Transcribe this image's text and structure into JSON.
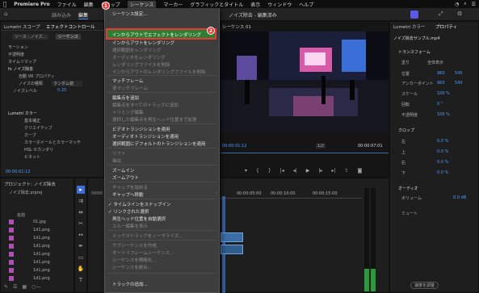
{
  "menubar": {
    "app_name": "Premiere Pro",
    "items": [
      "ファイル",
      "編集",
      "クリップ",
      "シーケンス",
      "マーカー",
      "グラフィックとタイトル",
      "表示",
      "ウィンドウ",
      "ヘルプ"
    ],
    "active": "シーケンス"
  },
  "workspace": {
    "tabs": [
      "読み込み",
      "編集"
    ],
    "doc_title": "ノイズ除去 - 編集済み"
  },
  "effect_controls": {
    "tabs": [
      "Lumetri スコープ",
      "エフェクトコントロール"
    ],
    "source_label": "ソース : ノイズ…",
    "seq_label": "シーケンス",
    "items": [
      {
        "label": "モーション"
      },
      {
        "label": "不透明度"
      },
      {
        "label": "タイムリマップ"
      },
      {
        "label": "fx ノイズ除去"
      },
      {
        "label": "自動 VR プロパティ"
      },
      {
        "label": "ノイズの種類",
        "value": "ランダム値"
      },
      {
        "label": "ノイズレベル",
        "value": "0.20"
      },
      {
        "label": "Lumetri カラー"
      },
      {
        "label": "基本補正"
      },
      {
        "label": "クリエイティブ"
      },
      {
        "label": "カーブ"
      },
      {
        "label": "カラーホイールとカラーマッチ"
      },
      {
        "label": "HSL セカンダリ"
      },
      {
        "label": "ビネット"
      }
    ],
    "timecode": "00:00:01:12"
  },
  "sequence_menu": {
    "items": [
      {
        "label": "シーケンス設定...",
        "enabled": true
      },
      {
        "label": "インからアウトでエフェクトをレンダリング",
        "enabled": true,
        "shortcut": "↵",
        "highlighted": true
      },
      {
        "label": "インからアウトをレンダリング",
        "enabled": true
      },
      {
        "label": "選択範囲をレンダリング",
        "enabled": false
      },
      {
        "label": "オーディオをレンダリング",
        "enabled": false
      },
      {
        "label": "レンダリングファイルを削除",
        "enabled": false
      },
      {
        "label": "インからアウトのレンダリングファイルを削除",
        "enabled": false
      },
      {
        "label": "マッチフレーム",
        "enabled": true
      },
      {
        "label": "逆マッチフレーム",
        "enabled": false
      },
      {
        "label": "編集点を追加",
        "enabled": true
      },
      {
        "label": "編集点をすべてのトラックに追加",
        "enabled": false
      },
      {
        "label": "トリミング編集",
        "enabled": false
      },
      {
        "label": "選択した編集点を再生ヘッド位置まで拡張",
        "enabled": false
      },
      {
        "label": "ビデオトランジションを適用",
        "enabled": true
      },
      {
        "label": "オーディオトランジションを適用",
        "enabled": true
      },
      {
        "label": "選択範囲にデフォルトのトランジションを適用",
        "enabled": true
      },
      {
        "label": "リフト",
        "enabled": false
      },
      {
        "label": "抽出",
        "enabled": false
      },
      {
        "label": "ズームイン",
        "enabled": true
      },
      {
        "label": "ズームアウト",
        "enabled": true
      },
      {
        "label": "ギャップを詰める",
        "enabled": false
      },
      {
        "label": "ギャップへ移動",
        "enabled": true,
        "submenu": true
      },
      {
        "label": "タイムラインをスナップイン",
        "enabled": true,
        "checked": true
      },
      {
        "label": "リンクされた選択",
        "enabled": true,
        "checked": true
      },
      {
        "label": "再生ヘッド位置を自動選択",
        "enabled": true
      },
      {
        "label": "スルー編集を表示",
        "enabled": false
      },
      {
        "label": "ミックストラックをノーマライズ...",
        "enabled": false
      },
      {
        "label": "サブシーケンスを作成",
        "enabled": false
      },
      {
        "label": "オートリフレームシーケンス...",
        "enabled": false
      },
      {
        "label": "シーケンスを簡略化...",
        "enabled": false
      },
      {
        "label": "シーケンスを統合...",
        "enabled": false
      },
      {
        "label": "トラックの追加...",
        "enabled": true
      }
    ],
    "badges": [
      "1",
      "2"
    ]
  },
  "program_monitor": {
    "title": "シーケンス 01",
    "timecode_left": "00:00:01:12",
    "zoom": "1/2",
    "timecode_right": "00:00:07:01"
  },
  "project_panel": {
    "title": "プロジェクト: ノイズ除去",
    "file": "ノイズ除去.prproj",
    "column": "名前",
    "files": [
      "01.jpg",
      "1d1.png",
      "1d1.png",
      "1d1.png",
      "1d1.png",
      "1d1.png",
      "1d1.png",
      "1d1.png"
    ]
  },
  "timeline": {
    "times": [
      "00:00:05:00",
      "00:00:10:00",
      "00:00:15:00"
    ]
  },
  "properties": {
    "tabs": [
      "Lumetri カラー",
      "プロパティ"
    ],
    "clip": "ノイズ除去サンプル.mp4",
    "section_transform": "トランスフォーム",
    "fit_label": "塗り",
    "fill_label": "全体表示",
    "position_label": "位置",
    "position_x": "960",
    "position_y": "540",
    "anchor_label": "アンカーポイント",
    "anchor_x": "960",
    "anchor_y": "540",
    "scale_label": "スケール",
    "scale_value": "100 %",
    "rotation_label": "回転",
    "rotation_value": "0 °",
    "opacity_label": "不透明度",
    "opacity_value": "100 %",
    "section_crop": "クロップ",
    "crop_labels": [
      "左",
      "上",
      "右",
      "下"
    ],
    "crop_values": [
      "0.0 %",
      "0.0 %",
      "0.0 %",
      "0.0 %"
    ],
    "section_audio": "オーディオ",
    "volume_label": "ボリューム",
    "volume_value": "0.0 dB",
    "mute_label": "ミュート",
    "footer_button": "速度を調整"
  },
  "colors": {
    "accent": "#4f9dff",
    "highlight": "#2f7d32",
    "callout": "#e53935"
  }
}
